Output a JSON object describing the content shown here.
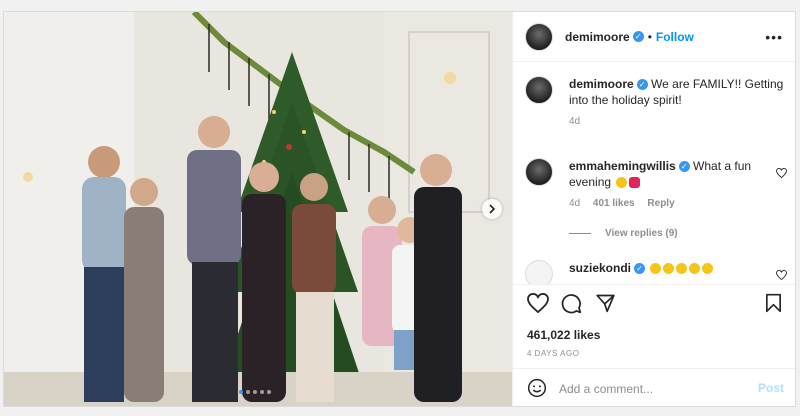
{
  "post": {
    "username": "demimoore",
    "follow_label": "Follow",
    "more_label": "•••",
    "caption_text": "We are FAMILY!! Getting into the holiday spirit!",
    "caption_age": "4d"
  },
  "comments": [
    {
      "username": "emmahemingwillis",
      "text": "What a fun evening",
      "age": "4d",
      "likes": "401 likes",
      "reply_label": "Reply",
      "view_replies": "View replies (9)"
    },
    {
      "username": "suziekondi",
      "text": ""
    }
  ],
  "stats": {
    "likes": "461,022 likes",
    "posted": "4 DAYS AGO"
  },
  "comment_box": {
    "placeholder": "Add a comment...",
    "post_label": "Post"
  },
  "colors": {
    "accent": "#0095f6",
    "verified": "#3897f0",
    "muted": "#8e8e8e"
  },
  "icons": [
    "heart-icon",
    "comment-icon",
    "share-icon",
    "bookmark-icon",
    "smiley-icon",
    "chevron-right-icon",
    "verified-icon",
    "more-icon"
  ]
}
